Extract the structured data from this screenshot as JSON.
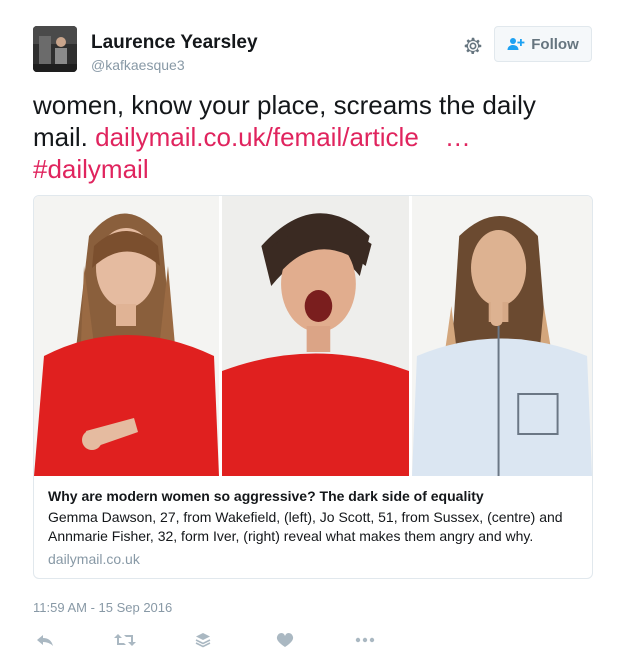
{
  "author": {
    "name": "Laurence Yearsley",
    "handle": "@kafkaesque3"
  },
  "follow_button": {
    "label": "Follow"
  },
  "tweet": {
    "text": "women, know your place, screams the daily mail. ",
    "link": "dailymail.co.uk/femail/article",
    "ellipsis": "…",
    "hashtag": "#dailymail"
  },
  "card": {
    "title": "Why are modern women so aggressive? The dark side of equality",
    "description": "Gemma Dawson, 27, from Wakefield, (left), Jo Scott, 51, from Sussex, (centre) and Annmarie Fisher, 32, form Iver, (right) reveal what makes them angry and why.",
    "domain": "dailymail.co.uk"
  },
  "timestamp": "11:59 AM - 15 Sep 2016",
  "colors": {
    "link": "#e0245e",
    "muted": "#8899a6",
    "text": "#14171a",
    "border": "#e1e8ed"
  },
  "icons": [
    "gear-icon",
    "follow-person-icon",
    "reply-icon",
    "retweet-icon",
    "buffer-icon",
    "heart-icon",
    "more-icon"
  ]
}
